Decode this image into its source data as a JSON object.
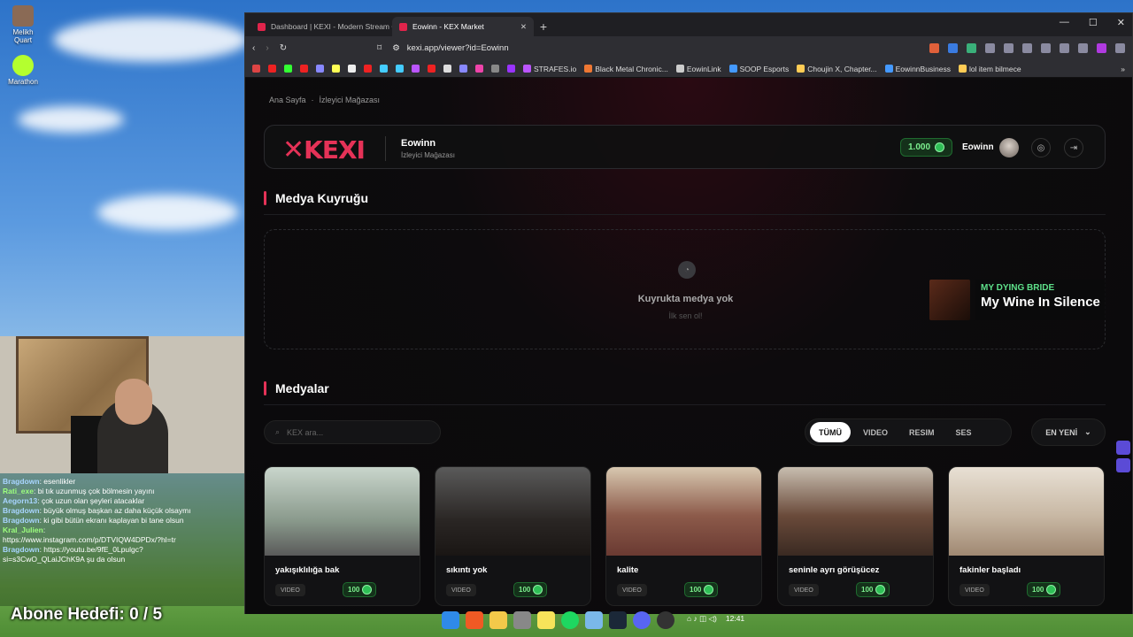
{
  "desktop": {
    "icons": [
      {
        "label": "Melikh Quart",
        "icon": "app-icon-photo"
      },
      {
        "label": "Marathon",
        "icon": "app-icon-marathon"
      }
    ]
  },
  "chat": {
    "lines": [
      {
        "user": "Bragdown",
        "text": ": esenlikler"
      },
      {
        "user": "Rati_exe",
        "text": ": bi tık uzunmuş çok bölmesin yayını"
      },
      {
        "user": "Aegorn13",
        "text": ": çok uzun olan şeyleri atacaklar"
      },
      {
        "user": "Bragdown",
        "text": ": büyük olmuş başkan az daha küçük olsaymı"
      },
      {
        "user": "Bragdown",
        "text": ": ki gibi bütün ekranı kaplayan bi tane olsun"
      },
      {
        "user": "Kral_Julien",
        "text": ":"
      },
      {
        "user": "",
        "text": "https://www.instagram.com/p/DTVIQW4DPDx/?hl=tr"
      },
      {
        "user": "Bragdown",
        "text": ": https://youtu.be/9fE_0Lpulgc?"
      },
      {
        "user": "",
        "text": "si=s3CwO_QLaiJChK9A şu da olsun"
      }
    ],
    "goal_label": "Abone Hedefi:",
    "goal_value": "0 / 5"
  },
  "browser": {
    "tabs": [
      {
        "title": "Dashboard | KEXI - Modern Stream C",
        "active": false
      },
      {
        "title": "Eowinn - KEX Market",
        "active": true
      }
    ],
    "new_tab": "+",
    "url": "kexi.app/viewer?id=Eowinn",
    "bookmarks": [
      "STRAFES.io",
      "Black Metal Chronic...",
      "EowinLink",
      "SOOP Esports",
      "Choujin X, Chapter...",
      "EowinnBusiness",
      "lol item bilmece"
    ]
  },
  "page": {
    "breadcrumb": [
      "Ana Sayfa",
      "İzleyici Mağazası"
    ],
    "logo_text": "KEXI",
    "store_name": "Eowinn",
    "store_sub": "İzleyici Mağazası",
    "balance": "1.000",
    "username": "Eowinn",
    "queue_title": "Medya Kuyruğu",
    "queue_empty": "Kuyrukta medya yok",
    "queue_empty_sub": "İlk sen ol!",
    "media_title": "Medyalar",
    "search_placeholder": "KEX ara...",
    "filters": [
      "TÜMÜ",
      "VIDEO",
      "RESIM",
      "SES"
    ],
    "active_filter": "TÜMÜ",
    "sort": "EN YENİ",
    "cards": [
      {
        "title": "yakışıklılığa bak",
        "type": "VIDEO",
        "price": "100"
      },
      {
        "title": "sıkıntı yok",
        "type": "VIDEO",
        "price": "100"
      },
      {
        "title": "kalite",
        "type": "VIDEO",
        "price": "100"
      },
      {
        "title": "seninle ayrı görüşücez",
        "type": "VIDEO",
        "price": "100"
      },
      {
        "title": "fakinler başladı",
        "type": "VIDEO",
        "price": "100"
      }
    ]
  },
  "now_playing": {
    "artist": "MY DYING BRIDE",
    "song": "My Wine In Silence"
  },
  "taskbar": {
    "time": "12:41"
  },
  "colors": {
    "accent": "#e53257",
    "coin": "#2fbf56",
    "now_playing_artist": "#5ee08a"
  }
}
